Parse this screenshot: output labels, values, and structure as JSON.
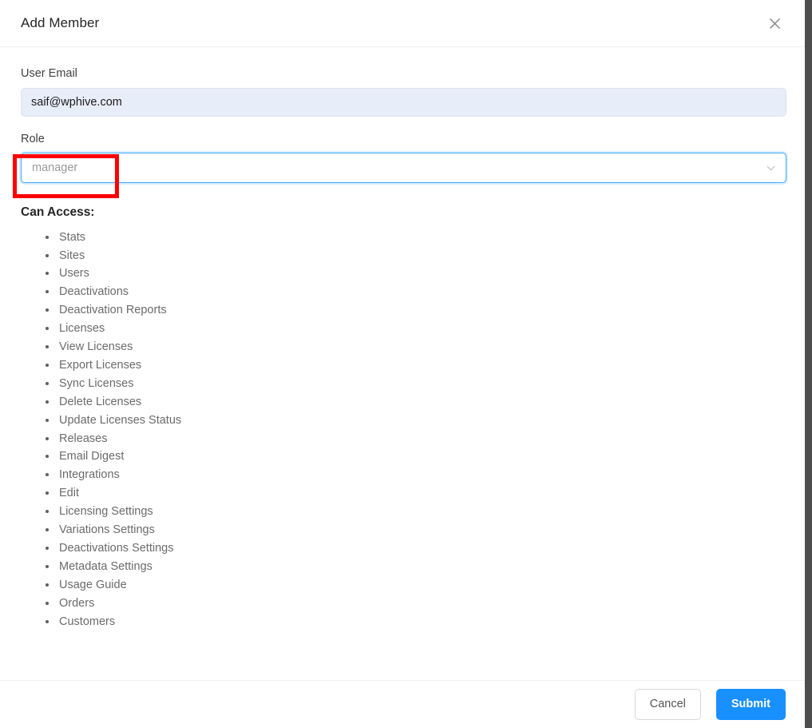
{
  "header": {
    "title": "Add Member",
    "close_icon": "close-icon"
  },
  "form": {
    "email": {
      "label": "User Email",
      "value": "saif@wphive.com",
      "placeholder": "User Email"
    },
    "role": {
      "label": "Role",
      "value": "manager",
      "placeholder": "manager",
      "dropdown_icon": "chevron-down-icon"
    }
  },
  "access": {
    "title": "Can Access:",
    "items": [
      "Stats",
      "Sites",
      "Users",
      "Deactivations",
      "Deactivation Reports",
      "Licenses",
      "View Licenses",
      "Export Licenses",
      "Sync Licenses",
      "Delete Licenses",
      "Update Licenses Status",
      "Releases",
      "Email Digest",
      "Integrations",
      "Edit",
      "Licensing Settings",
      "Variations Settings",
      "Deactivations Settings",
      "Metadata Settings",
      "Usage Guide",
      "Orders",
      "Customers"
    ]
  },
  "footer": {
    "cancel_label": "Cancel",
    "submit_label": "Submit"
  },
  "colors": {
    "primary": "#1890ff",
    "focus_border": "#40a9ff",
    "annotation": "#fe0000",
    "email_field_bg": "#e8edfa"
  }
}
